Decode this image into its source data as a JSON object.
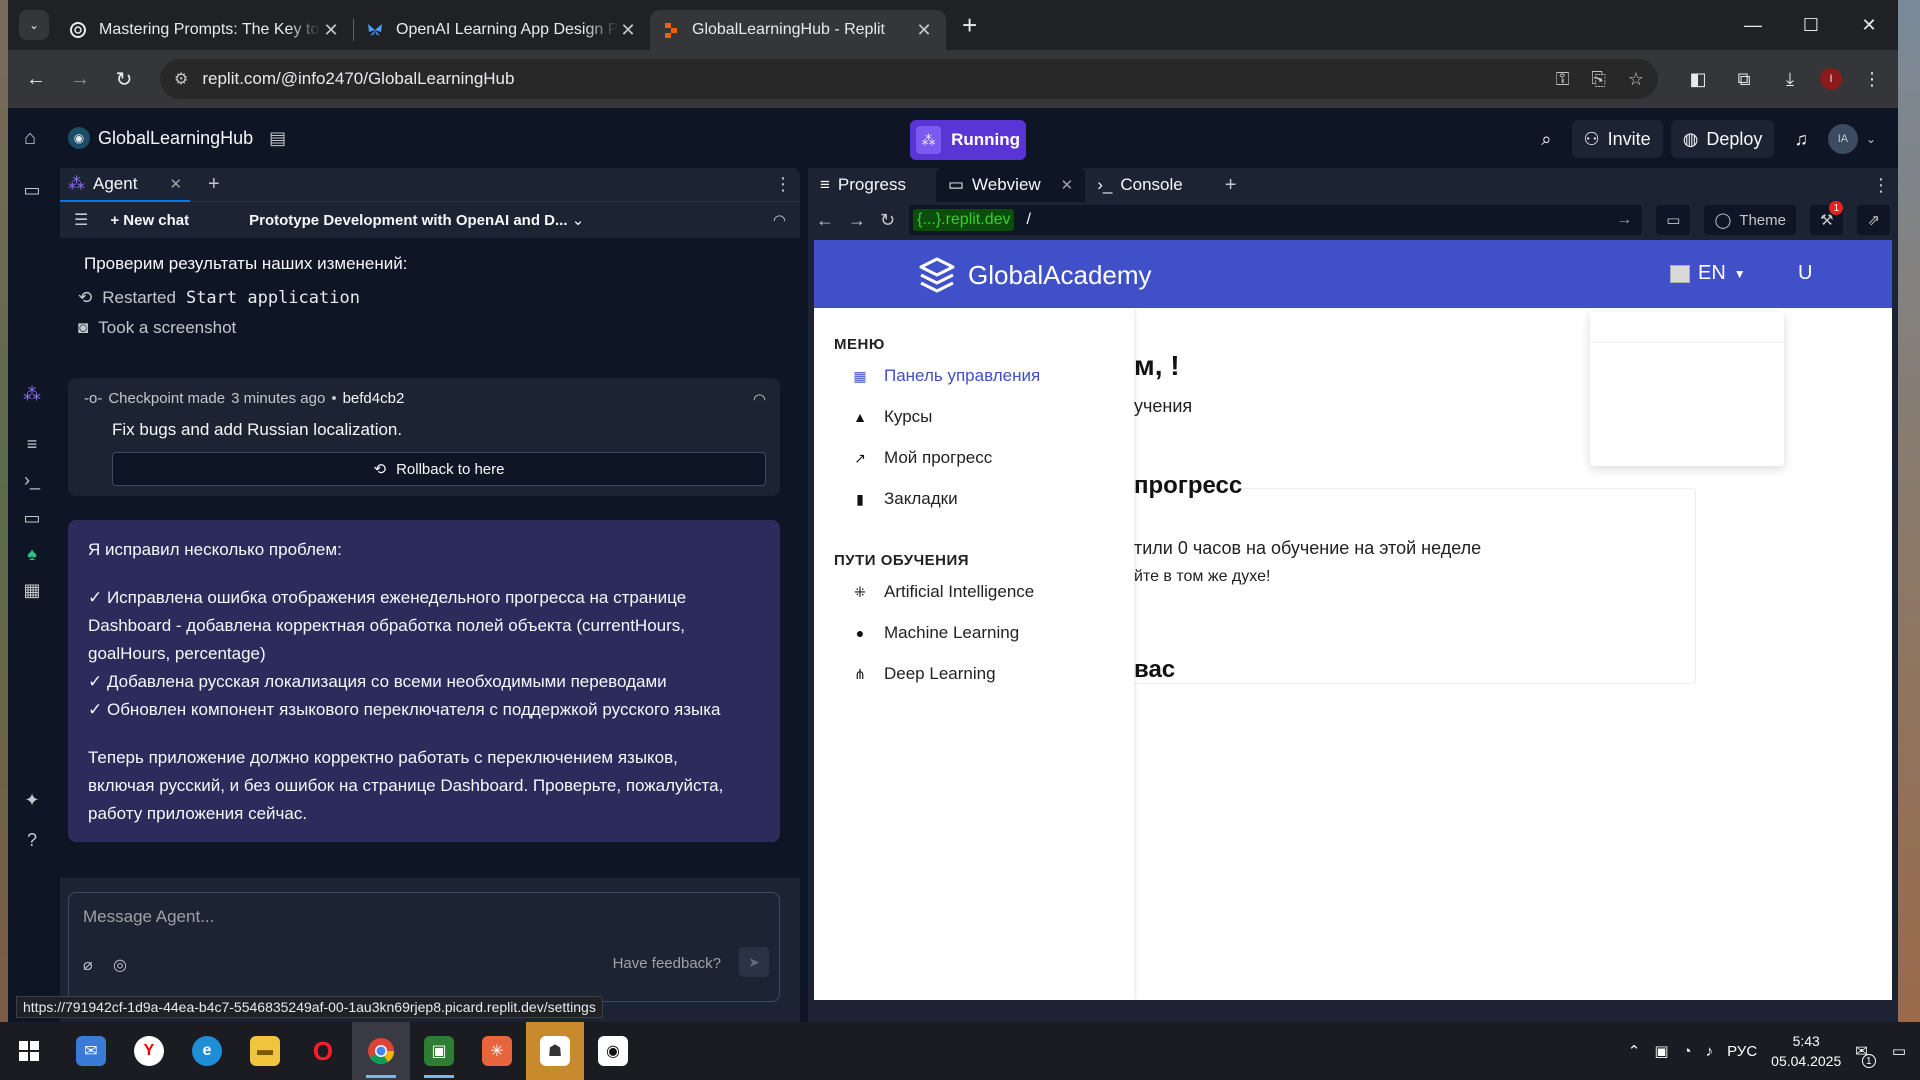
{
  "browser": {
    "tabs": [
      {
        "title": "Mastering Prompts: The Key to",
        "icon": "openai-icon",
        "active": false
      },
      {
        "title": "OpenAI Learning App Design Pr",
        "icon": "butterfly-icon",
        "active": false
      },
      {
        "title": "GlobalLearningHub - Replit",
        "icon": "replit-icon",
        "active": true
      }
    ],
    "url": "replit.com/@info2470/GlobalLearningHub",
    "status_url": "https://791942cf-1d9a-44ea-b4c7-5546835249af-00-1au3kn69rjep8.picard.replit.dev/settings",
    "profile_initial": "I"
  },
  "replit": {
    "repl_name": "GlobalLearningHub",
    "run_label": "Running",
    "invite_label": "Invite",
    "deploy_label": "Deploy",
    "user_initials": "IA",
    "agent_tab": "Agent",
    "new_chat": "New chat",
    "chat_title": "Prototype Development with OpenAI and D...",
    "messages": {
      "heading": "Проверим результаты наших изменений:",
      "restarted_prefix": "Restarted",
      "restarted_code": "Start application",
      "screenshot": "Took a screenshot",
      "checkpoint_label": "Checkpoint made",
      "checkpoint_time": "3 minutes ago",
      "checkpoint_bullet": "•",
      "checkpoint_hash": "befd4cb2",
      "checkpoint_msg": "Fix bugs and add Russian localization.",
      "rollback_label": "Rollback to here",
      "answer_intro": "Я исправил несколько проблем:",
      "answer_lines": [
        "✓ Исправлена ошибка отображения еженедельного прогресса на странице",
        "Dashboard - добавлена корректная обработка полей объекта (currentHours,",
        "goalHours, percentage)",
        "✓ Добавлена русская локализация со всеми необходимыми переводами",
        "✓ Обновлен компонент языкового переключателя с поддержкой русского языка"
      ],
      "answer_outro": [
        "Теперь приложение должно корректно работать с переключением языков,",
        "включая русский, и без ошибок на странице Dashboard. Проверьте, пожалуйста,",
        "работу приложения сейчас."
      ]
    },
    "composer": {
      "placeholder": "Message Agent...",
      "feedback": "Have feedback?"
    },
    "right_tabs": [
      "Progress",
      "Webview",
      "Console"
    ],
    "webview_url_host": "{...}.replit.dev",
    "webview_path": "/",
    "theme_label": "Theme",
    "notif_count": "1"
  },
  "app": {
    "brand": "GlobalAcademy",
    "lang": "EN",
    "user_initial": "U",
    "menu_title": "МЕНЮ",
    "menu_items": [
      "Панель управления",
      "Курсы",
      "Мой прогресс",
      "Закладки"
    ],
    "paths_title": "ПУТИ ОБУЧЕНИЯ",
    "path_items": [
      "Artificial Intelligence",
      "Machine Learning",
      "Deep Learning"
    ],
    "main": {
      "greeting": "м, !",
      "sub": "учения",
      "progress_title": "прогресс",
      "hours_text": "тили 0 часов на обучение на этой неделе",
      "keep_up": "йте в том же духе!",
      "for_you": "вас"
    }
  },
  "taskbar": {
    "lang": "РУС",
    "time": "5:43",
    "date": "05.04.2025",
    "notif_count": "1"
  },
  "colors": {
    "replit_bg": "#0e1525",
    "panel_bg": "#1c2333",
    "accent": "#5a35d6",
    "answer_bg": "#2d2a5c",
    "app_brand": "#4050c8"
  }
}
